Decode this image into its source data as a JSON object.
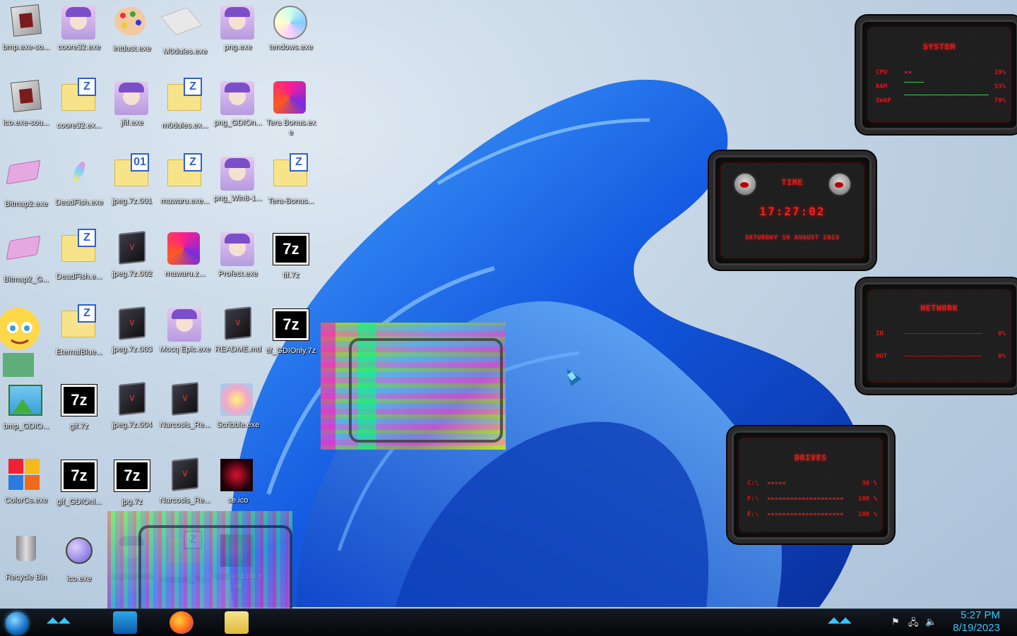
{
  "desktop": {
    "icons": [
      {
        "label": "bmp.exe-so..."
      },
      {
        "label": "coore32.exe"
      },
      {
        "label": "intdust.exe"
      },
      {
        "label": "M0dules.exe"
      },
      {
        "label": "png.exe"
      },
      {
        "label": "tendows.exe"
      },
      {
        "label": "ico.exe-sou..."
      },
      {
        "label": "coore32.ex..."
      },
      {
        "label": "jfif.exe"
      },
      {
        "label": "m0dules.ex..."
      },
      {
        "label": "png_GDIOn..."
      },
      {
        "label": "Tera Bonus.exe"
      },
      {
        "label": "Bitmap2.exe"
      },
      {
        "label": "DeadFish.exe"
      },
      {
        "label": "jpeg.7z.001"
      },
      {
        "label": "mawaru.exe..."
      },
      {
        "label": "png_Win8-1..."
      },
      {
        "label": "Tera-Bonus..."
      },
      {
        "label": "Bitmap2_G..."
      },
      {
        "label": "DeadFish.e..."
      },
      {
        "label": "jpeg.7z.002"
      },
      {
        "label": "mawaru.z..."
      },
      {
        "label": "Profect.exe"
      },
      {
        "label": "tif.7z"
      },
      {
        "label": "EternalBlue..."
      },
      {
        "label": "jpeg.7z.003"
      },
      {
        "label": "Mocq Epic.exe"
      },
      {
        "label": "README.md"
      },
      {
        "label": "tif_GDIOnly.7z"
      },
      {
        "label": "bmp_GDIO..."
      },
      {
        "label": "gif.7z"
      },
      {
        "label": "jpeg.7z.004"
      },
      {
        "label": "Narcosis_Re..."
      },
      {
        "label": "Scribble.exe"
      },
      {
        "label": "ColorCs.exe"
      },
      {
        "label": "gif_GDIOnl..."
      },
      {
        "label": "jpg.7z"
      },
      {
        "label": "Narcosis_Re..."
      },
      {
        "label": "se.ico"
      },
      {
        "label": "Recycle Bin"
      },
      {
        "label": "ico.exe"
      },
      {
        "label": "Laplace.exe"
      },
      {
        "label": "Narcosis_Re..."
      },
      {
        "label": "Sustain Epic.exe"
      }
    ]
  },
  "gadgets": {
    "system": {
      "title": "SYSTEM",
      "rows": [
        {
          "k": "CPU",
          "m": "»»",
          "v": "19%"
        },
        {
          "k": "RAM",
          "m": "",
          "v": "53%"
        },
        {
          "k": "SWAP",
          "m": "",
          "v": "79%"
        }
      ]
    },
    "time": {
      "title": "TIME",
      "clock": "17:27:02",
      "date": "SATURDAY 19 AUGUST 2023"
    },
    "network": {
      "title": "NETWORK",
      "rows": [
        {
          "k": "IN",
          "v": "0%"
        },
        {
          "k": "OUT",
          "v": "0%"
        }
      ]
    },
    "drives": {
      "title": "DRIVES",
      "rows": [
        {
          "k": "C:\\",
          "m": "»»»»»",
          "v": "30 %"
        },
        {
          "k": "F:\\",
          "m": "»»»»»»»»»»»»»»»»»»»»",
          "v": "100 %"
        },
        {
          "k": "E:\\",
          "m": "»»»»»»»»»»»»»»»»»»»»",
          "v": "100 %"
        }
      ]
    }
  },
  "taskbar": {
    "deco_left": "◢◣◢◣",
    "deco_right": "◢◣◢◣",
    "clock_time": "5:27 PM",
    "clock_date": "8/19/2023",
    "tray_icons": [
      "flag-icon",
      "network-icon",
      "speaker-icon"
    ]
  },
  "colors": {
    "accent": "#37c6ff",
    "gadget_red": "#e01a1a"
  }
}
